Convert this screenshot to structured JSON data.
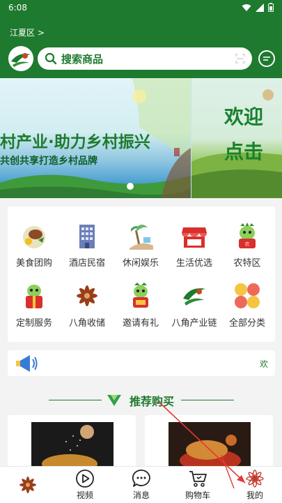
{
  "status": {
    "time": "6:08"
  },
  "header": {
    "location": "江夏区 >",
    "search_placeholder": "搜索商品"
  },
  "banner": {
    "slogan_main": "村产业·助力乡村振兴",
    "slogan_sub": "共创共享打造乡村品牌",
    "next_slide_line1": "欢迎",
    "next_slide_line2": "点击"
  },
  "categories": [
    {
      "label": "美食团购",
      "icon": "food-icon"
    },
    {
      "label": "酒店民宿",
      "icon": "hotel-icon"
    },
    {
      "label": "休闲娱乐",
      "icon": "leisure-icon"
    },
    {
      "label": "生活优选",
      "icon": "shop-icon"
    },
    {
      "label": "农特区",
      "icon": "mascot-icon"
    },
    {
      "label": "定制服务",
      "icon": "mascot-gift-icon"
    },
    {
      "label": "八角收储",
      "icon": "star-anise-icon"
    },
    {
      "label": "邀请有礼",
      "icon": "mascot-invite-icon"
    },
    {
      "label": "八角产业链",
      "icon": "industry-logo-icon"
    },
    {
      "label": "全部分类",
      "icon": "all-categories-icon"
    }
  ],
  "notice": {
    "text": "欢"
  },
  "section": {
    "title": "推荐购买"
  },
  "tabbar": {
    "items": [
      {
        "label": "",
        "icon": "home-anise-icon"
      },
      {
        "label": "视频",
        "icon": "play-icon"
      },
      {
        "label": "消息",
        "icon": "chat-icon"
      },
      {
        "label": "购物车",
        "icon": "cart-icon"
      },
      {
        "label": "我的",
        "icon": "profile-anise-icon"
      }
    ]
  },
  "colors": {
    "brand": "#1e7a2e",
    "accent_red": "#d9302c",
    "annotation_arrow": "#e53935"
  }
}
